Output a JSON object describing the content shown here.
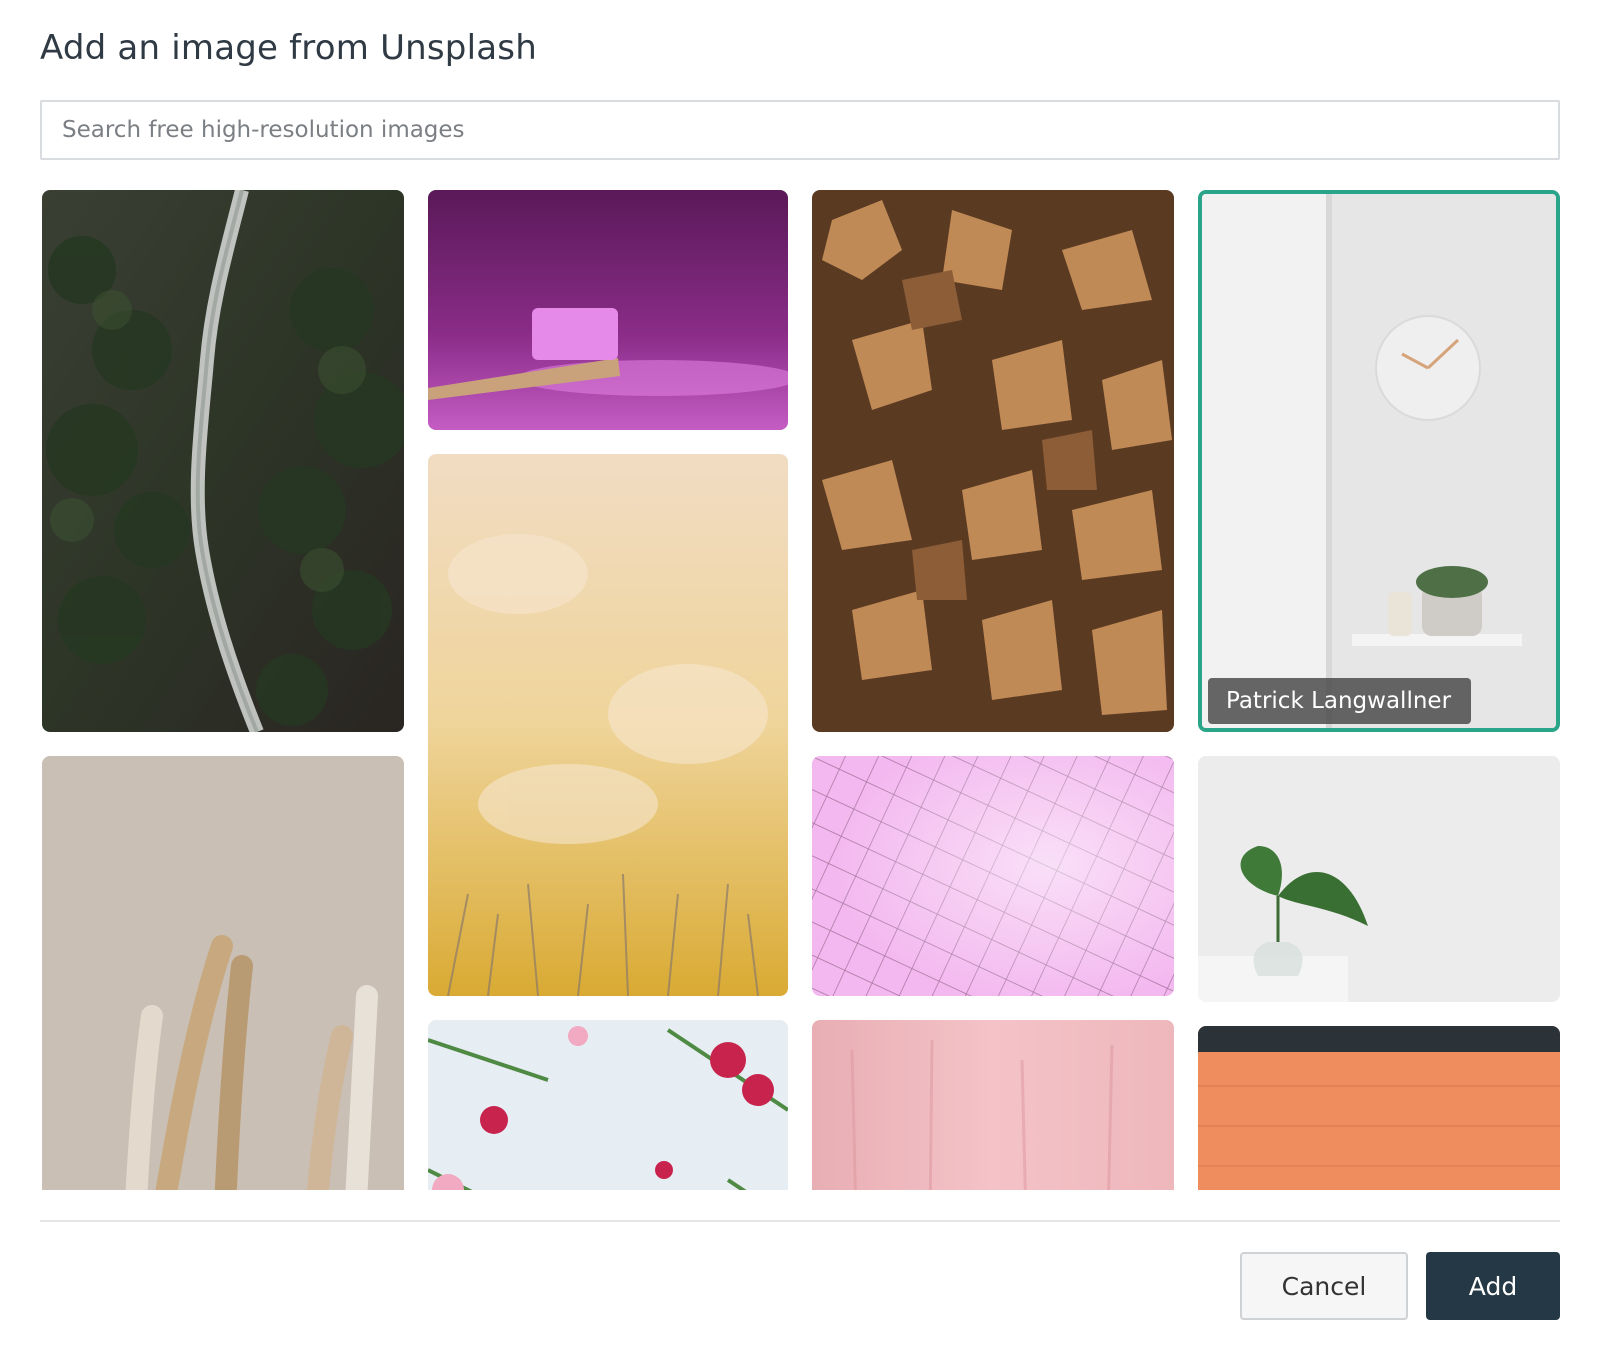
{
  "dialog": {
    "title": "Add an image from Unsplash"
  },
  "search": {
    "placeholder": "Search free high-resolution images",
    "value": ""
  },
  "grid": {
    "selected_photographer": "Patrick Langwallner",
    "selection_color": "#2aa58a"
  },
  "footer": {
    "cancel_label": "Cancel",
    "add_label": "Add"
  },
  "colors": {
    "primary_button": "#243845",
    "title_text": "#2f3a44"
  }
}
